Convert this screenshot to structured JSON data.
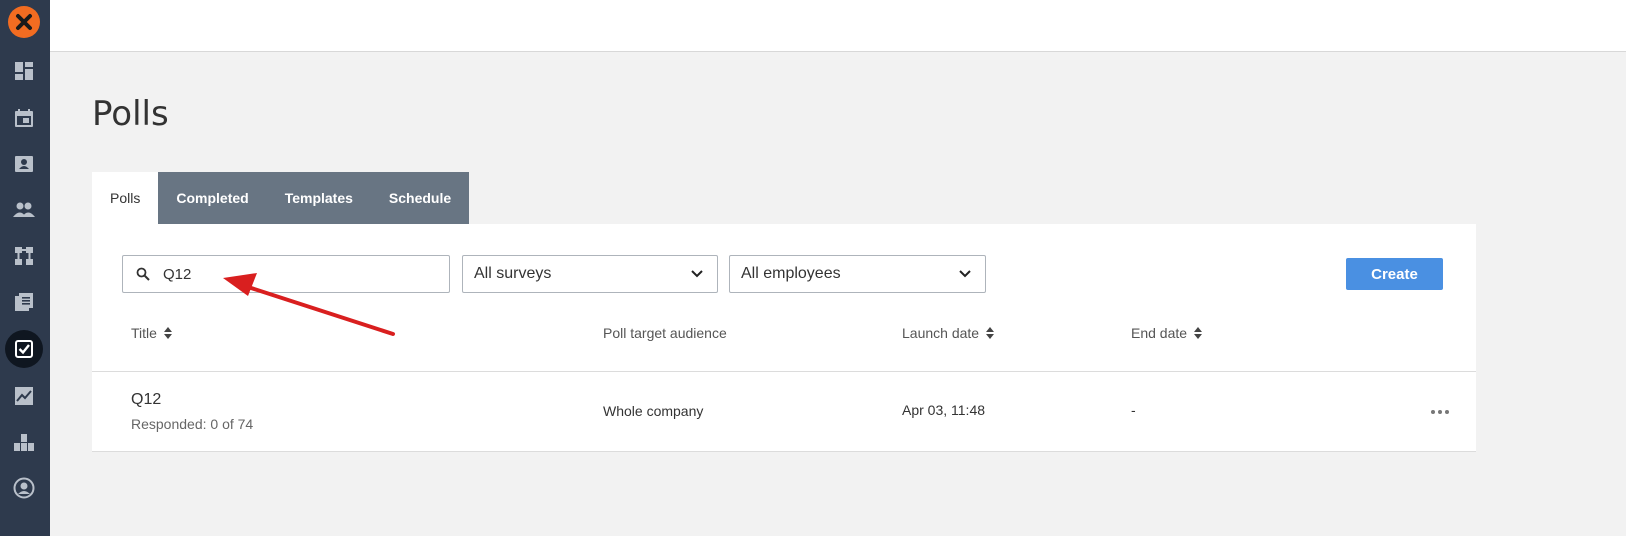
{
  "page": {
    "title": "Polls"
  },
  "sidebar": {
    "logo_icon": "logo-x",
    "items": [
      {
        "icon": "dashboard-icon"
      },
      {
        "icon": "calendar-icon"
      },
      {
        "icon": "contacts-icon"
      },
      {
        "icon": "people-icon"
      },
      {
        "icon": "org-chart-icon"
      },
      {
        "icon": "documents-icon"
      },
      {
        "icon": "polls-icon",
        "active": true
      },
      {
        "icon": "analytics-icon"
      },
      {
        "icon": "modules-icon"
      },
      {
        "icon": "profile-icon"
      }
    ]
  },
  "tabs": [
    {
      "label": "Polls",
      "active": true
    },
    {
      "label": "Completed"
    },
    {
      "label": "Templates"
    },
    {
      "label": "Schedule"
    }
  ],
  "filters": {
    "search_value": "Q12",
    "survey_filter": "All surveys",
    "employee_filter": "All employees"
  },
  "create_label": "Create",
  "table": {
    "columns": [
      "Title",
      "Poll target audience",
      "Launch date",
      "End date"
    ],
    "rows": [
      {
        "title": "Q12",
        "subtitle": "Responded: 0 of 74",
        "audience": "Whole company",
        "launch": "Apr 03, 11:48",
        "end": "-"
      }
    ]
  },
  "colors": {
    "sidebar": "#2e3a4d",
    "logo": "#f26c21",
    "tab_inactive": "#687583",
    "primary_button": "#4a90e2",
    "annotation_arrow": "#d91f1f"
  }
}
